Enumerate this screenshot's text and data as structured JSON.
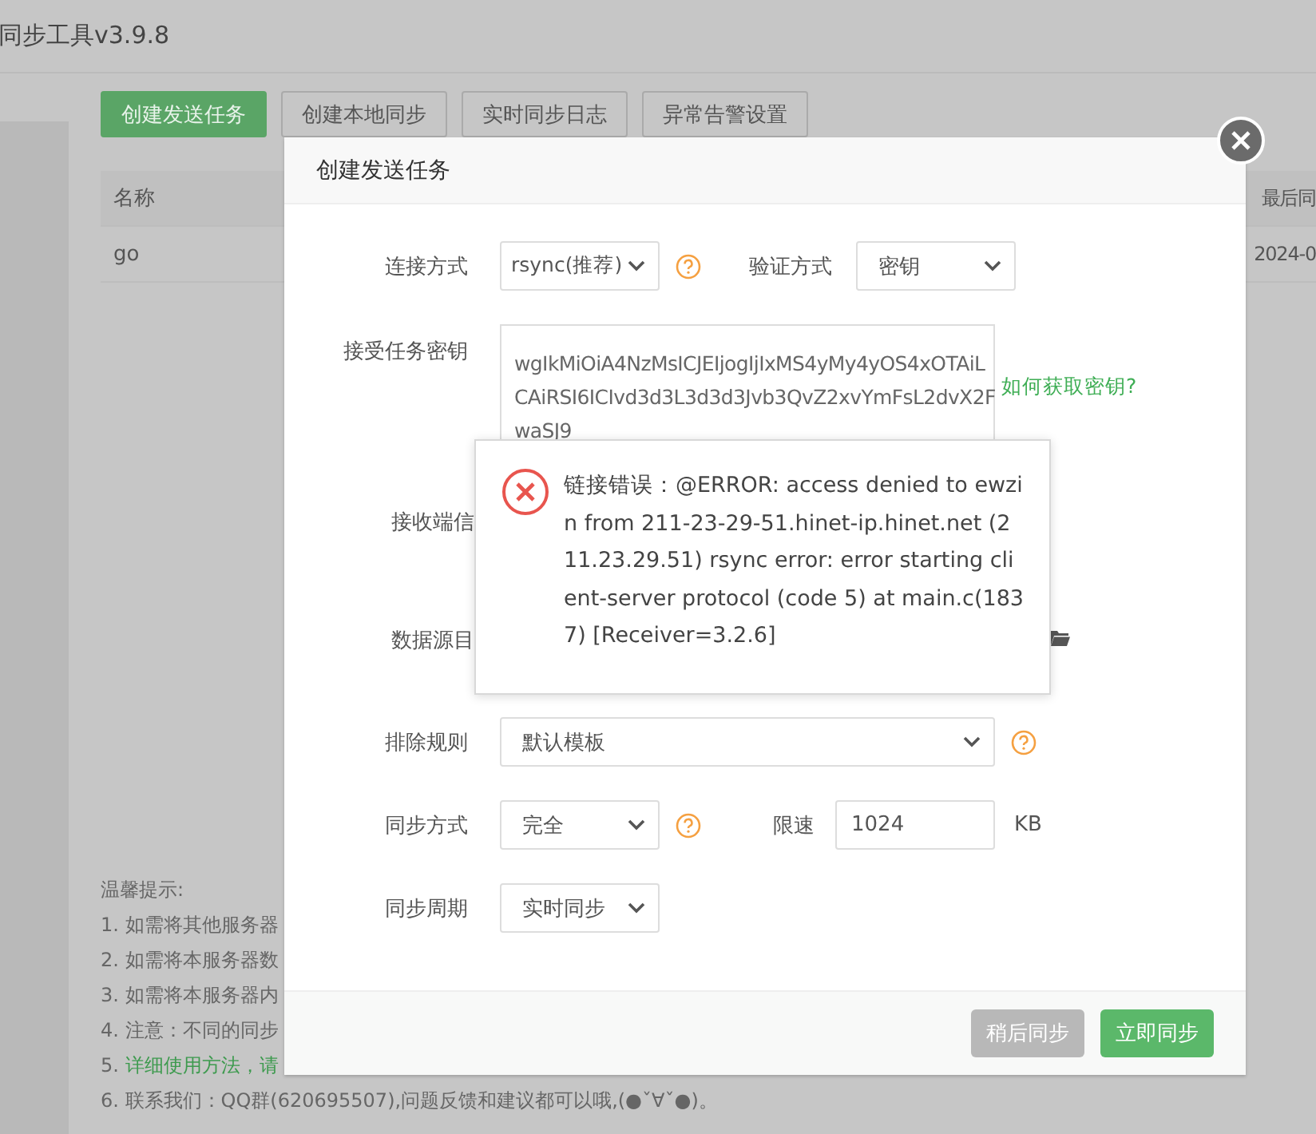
{
  "app": {
    "title": "同步工具v3.9.8"
  },
  "toolbar": [
    {
      "label": "创建发送任务",
      "primary": true
    },
    {
      "label": "创建本地同步",
      "primary": false
    },
    {
      "label": "实时同步日志",
      "primary": false
    },
    {
      "label": "异常告警设置",
      "primary": false
    }
  ],
  "table": {
    "columns": [
      "名称",
      "最后同"
    ],
    "rows": [
      [
        "go",
        "2024-0"
      ]
    ]
  },
  "tips": {
    "title": "温馨提示:",
    "items": [
      {
        "num": "1.",
        "text": "如需将其他服务器",
        "link": false
      },
      {
        "num": "2.",
        "text": "如需将本服务器数",
        "link": false
      },
      {
        "num": "3.",
        "text": "如需将本服务器内",
        "link": false
      },
      {
        "num": "4.",
        "text": "注意：不同的同步",
        "link": false
      },
      {
        "num": "5.",
        "text": "详细使用方法，请",
        "link": true
      },
      {
        "num": "6.",
        "text": "联系我们：QQ群(620695507),问题反馈和建议都可以哦,(●ˇ∀ˇ●)。",
        "link": false
      }
    ]
  },
  "dialog": {
    "title": "创建发送任务",
    "connection": {
      "label": "连接方式",
      "value": "rsync(推荐)",
      "auth_label": "验证方式",
      "auth_value": "密钥"
    },
    "key": {
      "label": "接受任务密钥",
      "lines": [
        "wgIkMiOiA4NzMsICJEIjogIjIxMS4yMy4yOS4xOTAiL",
        "CAiRSI6ICIvd3d3L3d3d3Jvb3QvZ2xvYmFsL2dvX2F",
        "waSJ9"
      ],
      "help_link": "如何获取密钥?"
    },
    "receiver_label": "接收端信",
    "source_label": "数据源目",
    "exclude": {
      "label": "排除规则",
      "value": "默认模板"
    },
    "sync_mode": {
      "label": "同步方式",
      "value": "完全",
      "limit_label": "限速",
      "limit_value": "1024",
      "unit": "KB"
    },
    "period": {
      "label": "同步周期",
      "value": "实时同步"
    },
    "buttons": [
      {
        "label": "稍后同步",
        "disabled": true
      },
      {
        "label": "立即同步",
        "disabled": false
      }
    ]
  },
  "error": {
    "message": "链接错误：@ERROR: access denied to ewzin from 211-23-29-51.hinet-ip.hinet.net (211.23.29.51) rsync error: error starting client-server protocol (code 5) at main.c(1837) [Receiver=3.2.6]"
  }
}
